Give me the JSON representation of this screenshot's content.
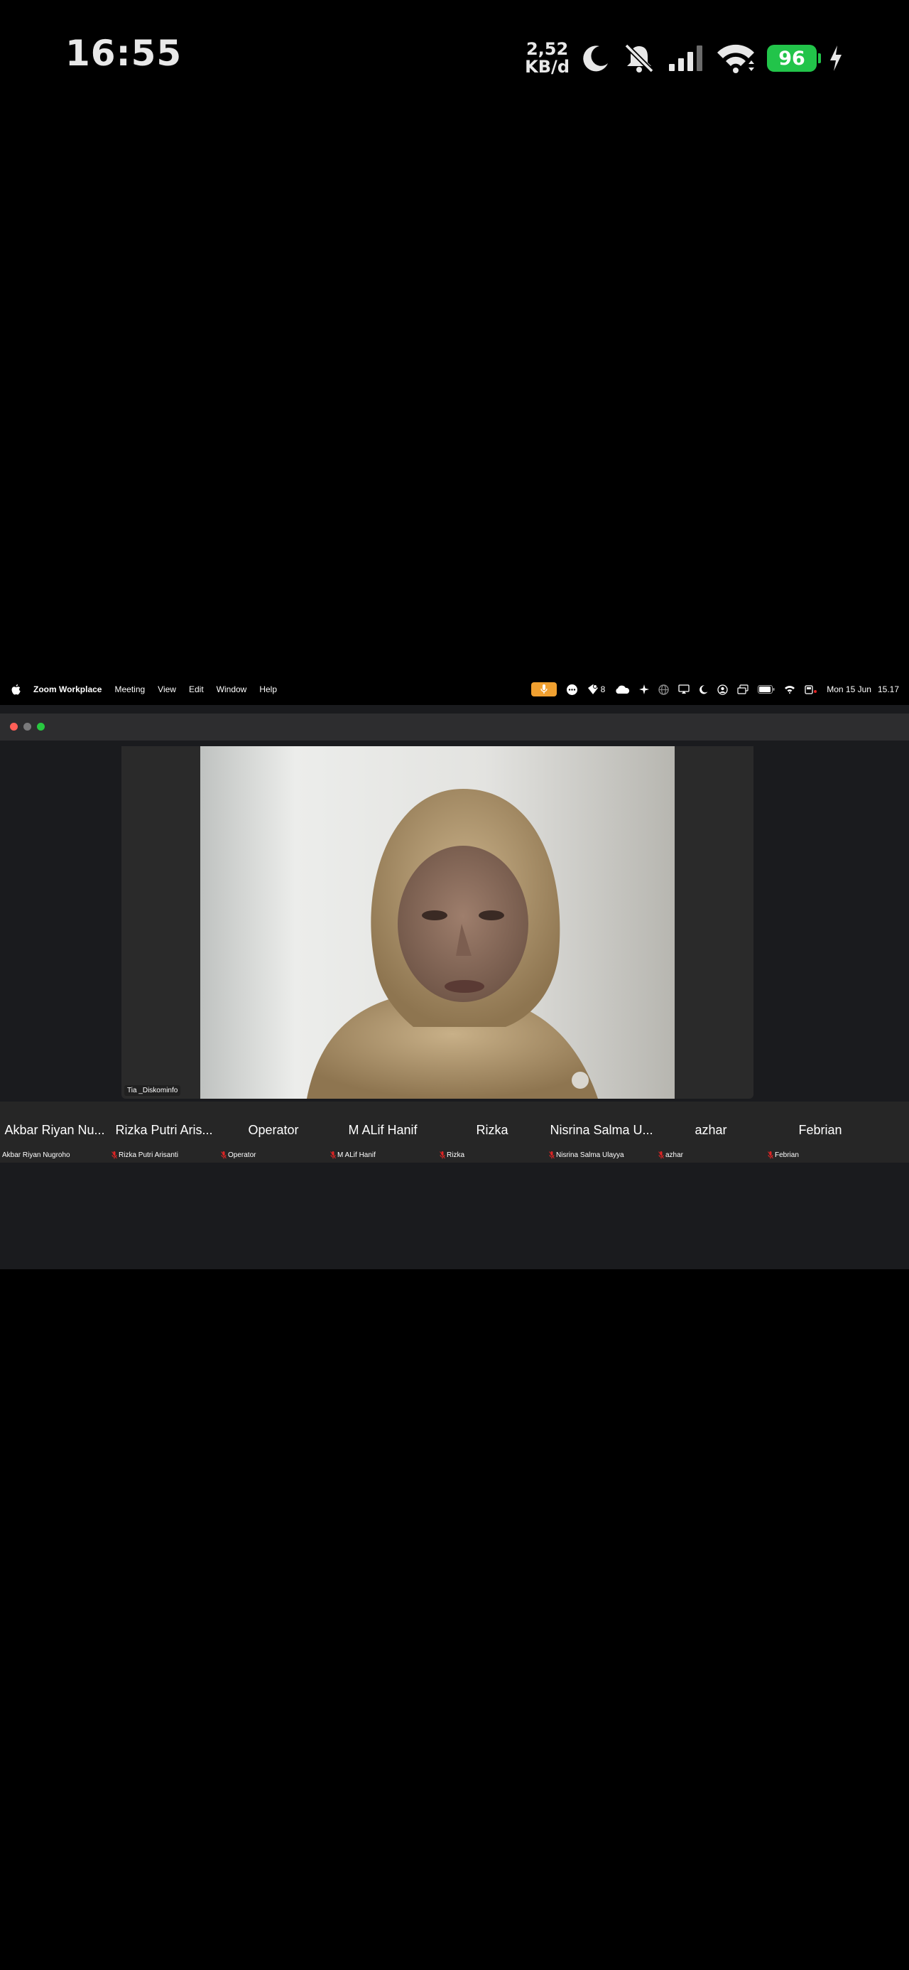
{
  "android_status": {
    "time": "16:55",
    "net_speed_value": "2,52",
    "net_speed_unit": "KB/d",
    "battery_level": "96"
  },
  "mac_menubar": {
    "app_name": "Zoom Workplace",
    "menus": [
      "Meeting",
      "View",
      "Edit",
      "Window",
      "Help"
    ],
    "notification_count": "8",
    "date": "Mon 15 Jun",
    "time": "15.17"
  },
  "zoom": {
    "active_speaker": "Tia _Diskominfo",
    "participants": [
      {
        "tile_label": "Akbar Riyan Nu...",
        "full_name": "Akbar Riyan Nugroho",
        "muted": false
      },
      {
        "tile_label": "Rizka Putri Aris...",
        "full_name": "Rizka Putri Arisanti",
        "muted": true
      },
      {
        "tile_label": "Operator",
        "full_name": "Operator",
        "muted": true
      },
      {
        "tile_label": "M ALif Hanif",
        "full_name": "M ALif Hanif",
        "muted": true
      },
      {
        "tile_label": "Rizka",
        "full_name": "Rizka",
        "muted": true
      },
      {
        "tile_label": "Nisrina Salma U...",
        "full_name": "Nisrina Salma Ulayya",
        "muted": true
      },
      {
        "tile_label": "azhar",
        "full_name": "azhar",
        "muted": true
      },
      {
        "tile_label": "Febrian",
        "full_name": "Febrian",
        "muted": true
      }
    ]
  },
  "colors": {
    "battery": "#22c44a",
    "mic_active": "#f0a030",
    "mute_red": "#e02424",
    "close": "#ff5f57",
    "maximize": "#28c840"
  }
}
